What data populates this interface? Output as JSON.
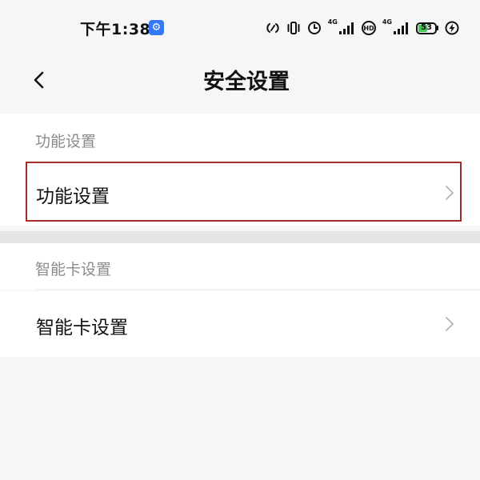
{
  "status_bar": {
    "time": "下午1:38",
    "network_1": "4G",
    "network_2": "4G",
    "battery_level": "53",
    "icons": [
      "settings-app-icon",
      "nfc-icon",
      "vibrate-icon",
      "alarm-icon",
      "signal-icon",
      "hd-icon",
      "signal-icon",
      "battery-icon",
      "charging-icon"
    ],
    "accent_color": "#3478f6",
    "battery_color": "#48c754"
  },
  "header": {
    "back_icon": "chevron-left-icon",
    "title": "安全设置"
  },
  "sections": [
    {
      "header": "功能设置",
      "items": [
        {
          "label": "功能设置",
          "icon": "chevron-right-icon",
          "highlighted": true
        }
      ]
    },
    {
      "header": "智能卡设置",
      "items": [
        {
          "label": "智能卡设置",
          "icon": "chevron-right-icon",
          "highlighted": false
        }
      ]
    }
  ],
  "highlight_color": "#a52a2a"
}
